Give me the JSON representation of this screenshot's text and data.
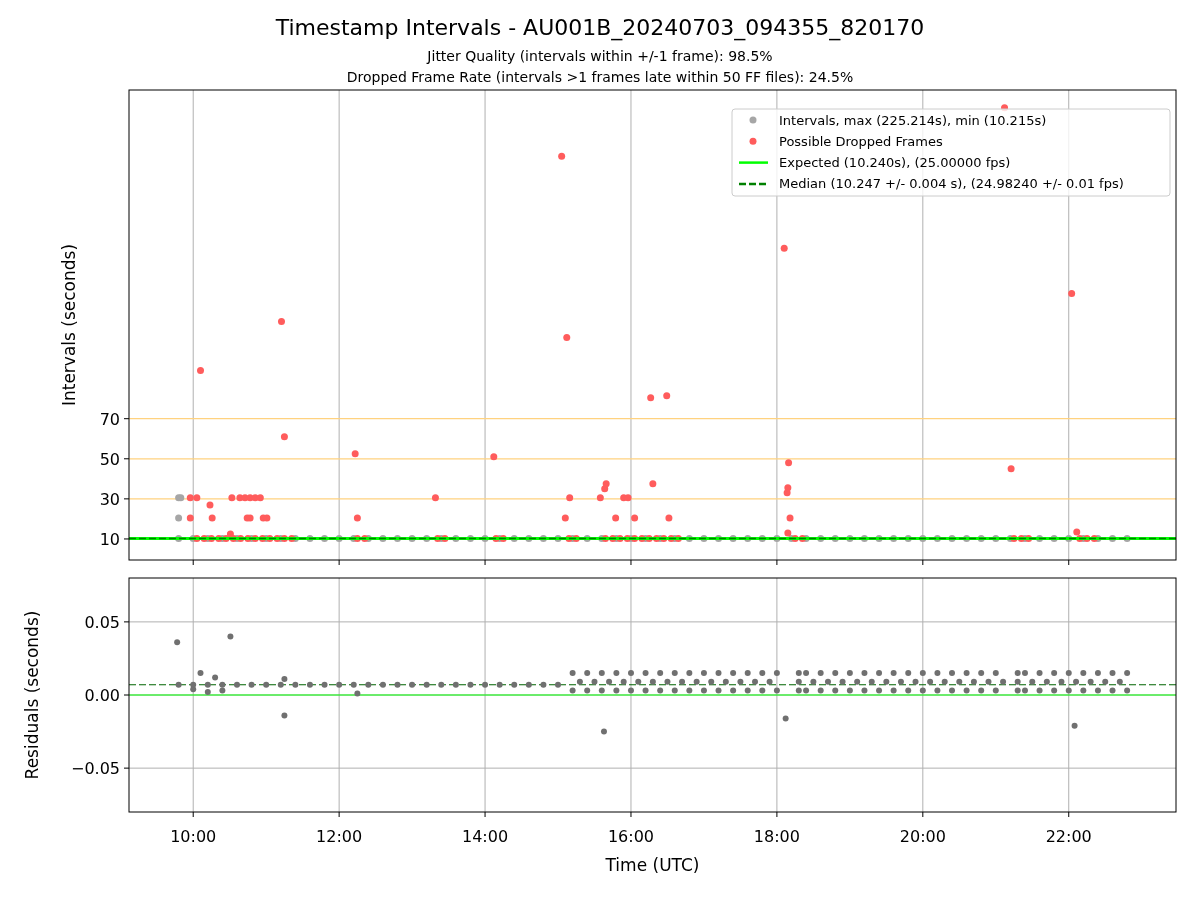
{
  "figure": {
    "title": "Timestamp Intervals - AU001B_20240703_094355_820170",
    "subtitles": [
      "Jitter Quality (intervals within +/-1 frame): 98.5%",
      "Dropped Frame Rate (intervals >1 frames late within 50 FF files): 24.5%"
    ]
  },
  "top_chart": {
    "chart_data": {
      "type": "scatter",
      "ylabel": "Intervals (seconds)",
      "xlim": [
        9.12,
        23.47
      ],
      "ylim": [
        -0.5,
        234
      ],
      "grid": "x",
      "legend": "upper right",
      "yticks": [
        {
          "value": 10,
          "label": "10"
        },
        {
          "value": 30,
          "label": "30"
        },
        {
          "value": 50,
          "label": "50"
        },
        {
          "value": 70,
          "label": "70"
        }
      ],
      "series": [
        {
          "name": "Intervals, max (225.214s), min (10.215s)",
          "color": "#a6a6a6",
          "x": [
            9.8,
            9.83,
            9.8,
            9.8,
            10,
            10.2,
            10.4,
            10.6,
            10.8,
            11,
            11.2,
            11.4,
            11.6,
            11.8,
            12,
            12.2,
            12.4,
            12.6,
            12.8,
            13,
            13.2,
            13.4,
            13.6,
            13.8,
            14,
            14.2,
            14.4,
            14.6,
            14.8,
            15,
            15.2,
            15.4,
            15.6,
            15.8,
            16,
            16.2,
            16.4,
            16.6,
            16.8,
            17,
            17.2,
            17.4,
            17.6,
            17.8,
            18,
            18.2,
            18.4,
            18.6,
            18.8,
            19,
            19.2,
            19.4,
            19.6,
            19.8,
            20,
            20.2,
            20.4,
            20.6,
            20.8,
            21,
            21.2,
            21.4,
            21.6,
            21.8,
            22,
            22.2,
            22.4,
            22.6,
            22.8
          ],
          "values": [
            30.5,
            30.5,
            20.5,
            10.2,
            10.2,
            10.2,
            10.2,
            10.2,
            10.2,
            10.2,
            10.2,
            10.2,
            10.2,
            10.2,
            10.2,
            10.2,
            10.2,
            10.2,
            10.2,
            10.2,
            10.2,
            10.2,
            10.2,
            10.2,
            10.2,
            10.2,
            10.2,
            10.2,
            10.2,
            10.2,
            10.2,
            10.2,
            10.2,
            10.2,
            10.2,
            10.2,
            10.2,
            10.2,
            10.2,
            10.2,
            10.2,
            10.2,
            10.2,
            10.2,
            10.2,
            10.2,
            10.2,
            10.2,
            10.2,
            10.2,
            10.2,
            10.2,
            10.2,
            10.2,
            10.2,
            10.2,
            10.2,
            10.2,
            10.2,
            10.2,
            10.2,
            10.2,
            10.2,
            10.2,
            10.2,
            10.2,
            10.2,
            10.2,
            10.2
          ]
        },
        {
          "name": "Possible Dropped Frames",
          "color": "#ff5c5c",
          "x": [
            10.1,
            11.21,
            11.25,
            12.22,
            12.25,
            13.32,
            14.12,
            15.05,
            15.12,
            15.16,
            15.1,
            15.58,
            15.64,
            15.66,
            15.79,
            15.9,
            15.96,
            16.05,
            16.27,
            16.3,
            16.49,
            16.52,
            18.1,
            18.14,
            18.15,
            18.16,
            18.18,
            18.15,
            21.12,
            21.21,
            22.04,
            22.11,
            9.96,
            10.05,
            9.96,
            10.23,
            10.26,
            10.53,
            10.64,
            10.71,
            10.78,
            10.85,
            10.92,
            10.74,
            10.78,
            10.96,
            11.01,
            10.51,
            10.05,
            10.15,
            10.25,
            10.35,
            10.45,
            10.55,
            10.65,
            10.75,
            10.85,
            10.95,
            11.05,
            11.15,
            11.25,
            11.35,
            12.25,
            12.35,
            13.35,
            13.45,
            14.15,
            14.25,
            15.15,
            15.25,
            15.65,
            15.75,
            15.85,
            15.95,
            16.05,
            16.15,
            16.25,
            16.35,
            16.45,
            16.55,
            16.65,
            18.25,
            18.35,
            21.25,
            21.35,
            21.45,
            22.15,
            22.25,
            22.35
          ],
          "values": [
            94,
            118.5,
            61,
            52.5,
            20.5,
            30.5,
            51,
            201,
            110.5,
            30.5,
            20.5,
            30.5,
            35,
            37.5,
            20.5,
            30.5,
            30.5,
            20.5,
            80.5,
            37.5,
            81.5,
            20.5,
            155,
            33,
            35.5,
            48,
            20.5,
            13,
            225.2,
            45,
            132.5,
            13.5,
            30.5,
            30.5,
            20.5,
            27,
            20.5,
            30.5,
            30.5,
            30.5,
            30.5,
            30.5,
            30.5,
            20.5,
            20.5,
            20.5,
            20.5,
            12.5,
            10.2,
            10.2,
            10.2,
            10.2,
            10.2,
            10.2,
            10.2,
            10.2,
            10.2,
            10.2,
            10.2,
            10.2,
            10.2,
            10.2,
            10.2,
            10.2,
            10.2,
            10.2,
            10.2,
            10.2,
            10.2,
            10.2,
            10.2,
            10.2,
            10.2,
            10.2,
            10.2,
            10.2,
            10.2,
            10.2,
            10.2,
            10.2,
            10.2,
            10.2,
            10.2,
            10.2,
            10.2,
            10.2,
            10.2,
            10.2,
            10.2
          ]
        }
      ],
      "ref_lines": [
        {
          "axis": "y",
          "value": 10.24,
          "label": "Expected (10.240s), (25.00000 fps)",
          "color": "#00ff00"
        },
        {
          "axis": "y",
          "value": 10.247,
          "label": "Median (10.247 +/- 0.004 s), (24.98240 +/- 0.01 fps)",
          "color": "#008000"
        },
        {
          "axis": "y",
          "value": 30,
          "color": "#ffd27f"
        },
        {
          "axis": "y",
          "value": 50,
          "color": "#ffd27f"
        },
        {
          "axis": "y",
          "value": 70,
          "color": "#ffd27f"
        }
      ]
    }
  },
  "bottom_chart": {
    "chart_data": {
      "type": "scatter",
      "xlabel": "Time (UTC)",
      "ylabel": "Residuals (seconds)",
      "xlim": [
        9.12,
        23.47
      ],
      "ylim": [
        -0.08,
        0.08
      ],
      "grid": "both",
      "xticks": [
        {
          "value": 10,
          "label": "10:00"
        },
        {
          "value": 12,
          "label": "12:00"
        },
        {
          "value": 14,
          "label": "14:00"
        },
        {
          "value": 16,
          "label": "16:00"
        },
        {
          "value": 18,
          "label": "18:00"
        },
        {
          "value": 20,
          "label": "20:00"
        },
        {
          "value": 22,
          "label": "22:00"
        }
      ],
      "yticks": [
        {
          "value": 0.05,
          "label": "0.05"
        },
        {
          "value": 0,
          "label": "0.00"
        },
        {
          "value": -0.05,
          "label": "−0.05"
        }
      ],
      "series": [
        {
          "color": "#707070",
          "x": [
            9.78,
            10.51,
            11.25,
            15.63,
            18.12,
            22.08,
            10.1,
            10.0,
            10.2,
            10.4,
            10.3,
            11.25,
            12.25,
            9.8,
            10,
            10.2,
            10.4,
            10.6,
            10.8,
            11,
            11.2,
            11.4,
            11.6,
            11.8,
            12,
            12.2,
            12.4,
            12.6,
            12.8,
            13,
            13.2,
            13.4,
            13.6,
            13.8,
            14,
            14.2,
            14.4,
            14.6,
            14.8,
            15,
            15.2,
            15.4,
            15.6,
            15.8,
            16,
            16.2,
            16.4,
            16.6,
            16.8,
            17,
            17.2,
            17.4,
            17.6,
            17.8,
            18,
            18.3,
            18.4,
            18.6,
            18.8,
            19,
            19.2,
            19.4,
            19.6,
            19.8,
            20,
            20.2,
            20.4,
            20.6,
            20.8,
            21,
            21.3,
            21.4,
            21.6,
            21.8,
            22,
            22.2,
            22.4,
            22.6,
            22.8,
            15.3,
            15.5,
            15.7,
            15.9,
            16.1,
            16.3,
            16.5,
            16.7,
            16.9,
            17.1,
            17.3,
            17.5,
            17.7,
            17.9,
            18.3,
            18.5,
            18.7,
            18.9,
            19.1,
            19.3,
            19.5,
            19.7,
            19.9,
            20.1,
            20.3,
            20.5,
            20.7,
            20.9,
            21.1,
            21.3,
            21.5,
            21.7,
            21.9,
            22.1,
            22.3,
            22.5,
            22.7,
            15.2,
            15.4,
            15.6,
            15.8,
            16,
            16.2,
            16.4,
            16.6,
            16.8,
            17,
            17.2,
            17.4,
            17.6,
            17.8,
            18,
            18.3,
            18.4,
            18.6,
            18.8,
            19,
            19.2,
            19.4,
            19.6,
            19.8,
            20,
            20.2,
            20.4,
            20.6,
            20.8,
            21,
            21.3,
            21.4,
            21.6,
            21.8,
            22,
            22.2,
            22.4,
            22.6,
            22.8
          ],
          "values": [
            0.036,
            0.04,
            -0.014,
            -0.025,
            -0.016,
            -0.021,
            0.015,
            0.004,
            0.002,
            0.003,
            0.012,
            0.011,
            0.001,
            0.007,
            0.007,
            0.007,
            0.007,
            0.007,
            0.007,
            0.007,
            0.007,
            0.007,
            0.007,
            0.007,
            0.007,
            0.007,
            0.007,
            0.007,
            0.007,
            0.007,
            0.007,
            0.007,
            0.007,
            0.007,
            0.007,
            0.007,
            0.007,
            0.007,
            0.007,
            0.007,
            0.015,
            0.015,
            0.015,
            0.015,
            0.015,
            0.015,
            0.015,
            0.015,
            0.015,
            0.015,
            0.015,
            0.015,
            0.015,
            0.015,
            0.015,
            0.015,
            0.015,
            0.015,
            0.015,
            0.015,
            0.015,
            0.015,
            0.015,
            0.015,
            0.015,
            0.015,
            0.015,
            0.015,
            0.015,
            0.015,
            0.015,
            0.015,
            0.015,
            0.015,
            0.015,
            0.015,
            0.015,
            0.015,
            0.015,
            0.009,
            0.009,
            0.009,
            0.009,
            0.009,
            0.009,
            0.009,
            0.009,
            0.009,
            0.009,
            0.009,
            0.009,
            0.009,
            0.009,
            0.009,
            0.009,
            0.009,
            0.009,
            0.009,
            0.009,
            0.009,
            0.009,
            0.009,
            0.009,
            0.009,
            0.009,
            0.009,
            0.009,
            0.009,
            0.009,
            0.009,
            0.009,
            0.009,
            0.009,
            0.009,
            0.009,
            0.009,
            0.003,
            0.003,
            0.003,
            0.003,
            0.003,
            0.003,
            0.003,
            0.003,
            0.003,
            0.003,
            0.003,
            0.003,
            0.003,
            0.003,
            0.003,
            0.003,
            0.003,
            0.003,
            0.003,
            0.003,
            0.003,
            0.003,
            0.003,
            0.003,
            0.003,
            0.003,
            0.003,
            0.003,
            0.003,
            0.003,
            0.003,
            0.003,
            0.003,
            0.003,
            0.003,
            0.003,
            0.003,
            0.003,
            0.003
          ]
        }
      ],
      "ref_lines": [
        {
          "axis": "y",
          "value": 0,
          "color": "#00ff00"
        },
        {
          "axis": "y",
          "value": 0.007,
          "color": "#006400"
        }
      ]
    }
  }
}
